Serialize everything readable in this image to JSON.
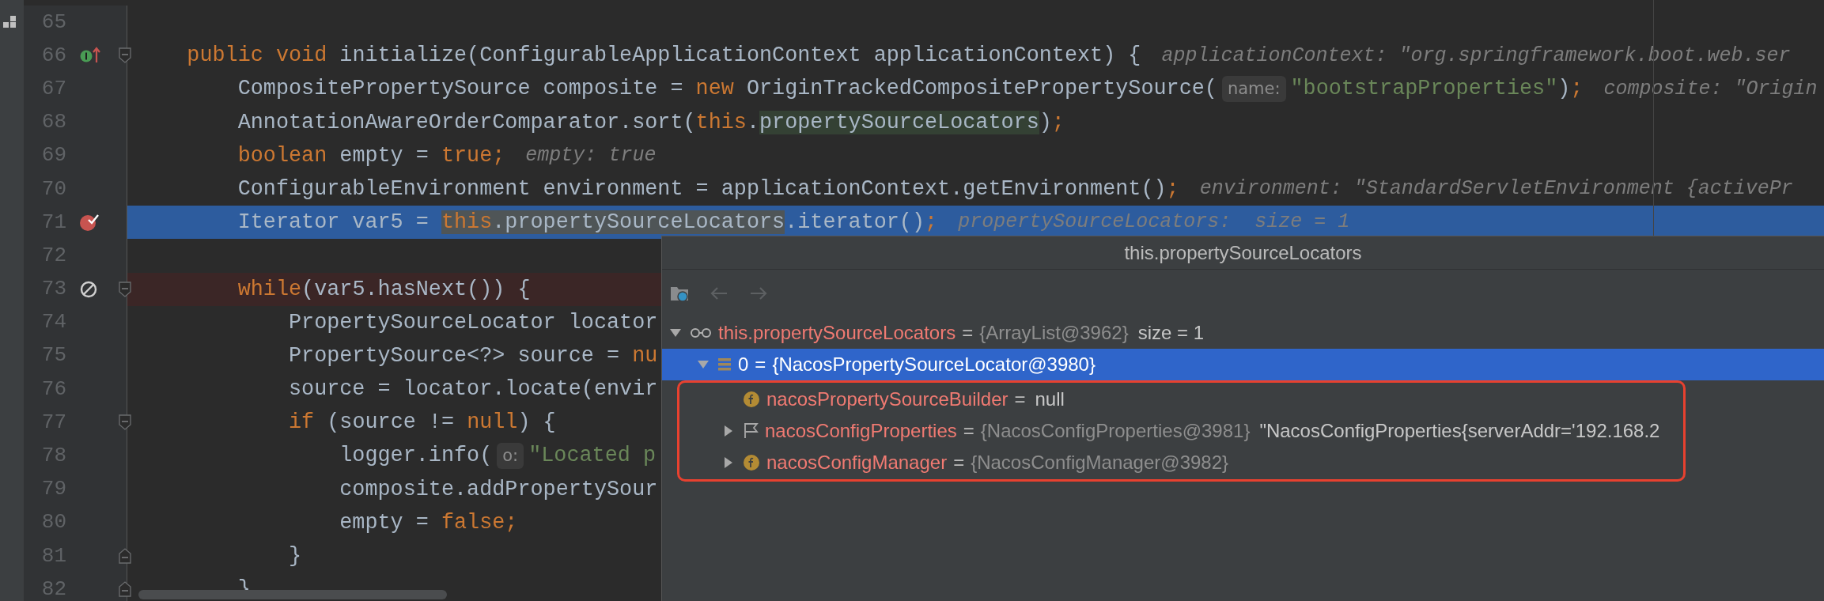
{
  "editor": {
    "lines": [
      {
        "number": "65",
        "current": false
      },
      {
        "number": "66",
        "current": false,
        "gutter_icon": {
          "kind": "implements"
        },
        "fold_marker": {
          "kind": "start"
        },
        "tokens": [
          {
            "text": "    public void",
            "kind": "keyword",
            "selected": false
          },
          {
            "text": " initialize(ConfigurableApplicationContext applicationContext) {",
            "kind": "plain",
            "selected": false
          },
          {
            "text": "applicationContext: \"org.springframework.boot.web.ser",
            "kind": "hint",
            "selected": false
          }
        ]
      },
      {
        "number": "67",
        "current": false,
        "tokens": [
          {
            "text": "        CompositePropertySource composite = ",
            "kind": "plain",
            "selected": false
          },
          {
            "text": "new",
            "kind": "keyword",
            "selected": false
          },
          {
            "text": " OriginTrackedCompositePropertySource(",
            "kind": "plain",
            "selected": false
          },
          {
            "text": "name:",
            "kind": "param",
            "selected": false
          },
          {
            "text": "\"bootstrapProperties\"",
            "kind": "string",
            "selected": false
          },
          {
            "text": ")",
            "kind": "plain",
            "selected": false
          },
          {
            "text": ";",
            "kind": "keyword",
            "selected": false
          },
          {
            "text": "composite: \"Origin",
            "kind": "hint",
            "selected": false
          }
        ]
      },
      {
        "number": "68",
        "current": false,
        "tokens": [
          {
            "text": "        AnnotationAwareOrderComparator.sort(",
            "kind": "plain",
            "selected": false
          },
          {
            "text": "this",
            "kind": "keyword",
            "selected": false
          },
          {
            "text": ".",
            "kind": "plain",
            "selected": false
          },
          {
            "text": "propertySourceLocators",
            "kind": "usage",
            "selected": false
          },
          {
            "text": ")",
            "kind": "plain",
            "selected": false
          },
          {
            "text": ";",
            "kind": "keyword",
            "selected": false
          }
        ]
      },
      {
        "number": "69",
        "current": false,
        "tokens": [
          {
            "text": "        boolean",
            "kind": "keyword",
            "selected": false
          },
          {
            "text": " empty = ",
            "kind": "plain",
            "selected": false
          },
          {
            "text": "true;",
            "kind": "keyword",
            "selected": false
          },
          {
            "text": "empty: true",
            "kind": "hint",
            "selected": false
          }
        ]
      },
      {
        "number": "70",
        "current": false,
        "tokens": [
          {
            "text": "        ConfigurableEnvironment environment = applicationContext.getEnvironment()",
            "kind": "plain",
            "selected": false
          },
          {
            "text": ";",
            "kind": "keyword",
            "selected": false
          },
          {
            "text": "environment: \"StandardServletEnvironment {activePr",
            "kind": "hint",
            "selected": false
          }
        ]
      },
      {
        "number": "71",
        "current": true,
        "gutter_icon": {
          "kind": "breakpoint",
          "enabled": true
        },
        "tokens": [
          {
            "text": "        Iterator var5 = ",
            "kind": "plain",
            "selected": false
          },
          {
            "text": "this",
            "kind": "keyword",
            "selected": true
          },
          {
            "text": ".propertySourceLocators",
            "kind": "plain",
            "selected": true
          },
          {
            "text": ".iterator()",
            "kind": "plain",
            "selected": false
          },
          {
            "text": ";",
            "kind": "keyword",
            "selected": false
          },
          {
            "text": "propertySourceLocators:  size = 1",
            "kind": "hint",
            "selected": false
          }
        ]
      },
      {
        "number": "72",
        "current": false
      },
      {
        "number": "73",
        "current": false,
        "gutter_icon": {
          "kind": "breakpoint",
          "enabled": false
        },
        "fold_marker": {
          "kind": "start"
        },
        "tokens": [
          {
            "text": "        while",
            "kind": "keyword",
            "selected": false
          },
          {
            "text": "(var5.hasNext()) {",
            "kind": "plain",
            "selected": false
          }
        ]
      },
      {
        "number": "74",
        "current": false,
        "tokens": [
          {
            "text": "            PropertySourceLocator locator",
            "kind": "plain",
            "selected": false
          }
        ]
      },
      {
        "number": "75",
        "current": false,
        "tokens": [
          {
            "text": "            PropertySource<?> source = ",
            "kind": "plain",
            "selected": false
          },
          {
            "text": "nu",
            "kind": "keyword",
            "selected": false
          }
        ]
      },
      {
        "number": "76",
        "current": false,
        "tokens": [
          {
            "text": "            source = locator.locate(envir",
            "kind": "plain",
            "selected": false
          }
        ]
      },
      {
        "number": "77",
        "current": false,
        "fold_marker": {
          "kind": "start"
        },
        "tokens": [
          {
            "text": "            if",
            "kind": "keyword",
            "selected": false
          },
          {
            "text": " (source != ",
            "kind": "plain",
            "selected": false
          },
          {
            "text": "null",
            "kind": "keyword",
            "selected": false
          },
          {
            "text": ") {",
            "kind": "plain",
            "selected": false
          }
        ]
      },
      {
        "number": "78",
        "current": false,
        "tokens": [
          {
            "text": "                logger.info(",
            "kind": "plain",
            "selected": false
          },
          {
            "text": "o:",
            "kind": "param",
            "selected": false
          },
          {
            "text": "\"Located p",
            "kind": "string",
            "selected": false
          }
        ]
      },
      {
        "number": "79",
        "current": false,
        "tokens": [
          {
            "text": "                composite.addPropertySour",
            "kind": "plain",
            "selected": false
          }
        ]
      },
      {
        "number": "80",
        "current": false,
        "tokens": [
          {
            "text": "                empty = ",
            "kind": "plain",
            "selected": false
          },
          {
            "text": "false;",
            "kind": "keyword",
            "selected": false
          }
        ]
      },
      {
        "number": "81",
        "current": false,
        "fold_marker": {
          "kind": "end"
        },
        "tokens": [
          {
            "text": "            }",
            "kind": "plain",
            "selected": false
          }
        ]
      },
      {
        "number": "82",
        "current": false,
        "fold_marker": {
          "kind": "end"
        },
        "tokens": [
          {
            "text": "        }",
            "kind": "plain",
            "selected": false
          }
        ]
      }
    ]
  },
  "popup": {
    "title": "this.propertySourceLocators",
    "nav": [
      {
        "kind": "back",
        "enabled": false
      },
      {
        "kind": "forward",
        "enabled": false
      }
    ],
    "tree": [
      {
        "kind": "watch",
        "expandable": true,
        "expanded": true,
        "name": "this.propertySourceLocators",
        "operator": "=",
        "value": "{ArrayList@3962}",
        "text": "size = 1",
        "selected": false,
        "outlined_children": false,
        "children": [
          {
            "kind": "element",
            "expandable": true,
            "expanded": true,
            "name": "0",
            "operator": "=",
            "value": "{NacosPropertySourceLocator@3980}",
            "selected": true,
            "outlined_children": true,
            "children": [
              {
                "kind": "field",
                "expandable": false,
                "name": "nacosPropertySourceBuilder",
                "operator": "=",
                "text": "null",
                "selected": false
              },
              {
                "kind": "flag",
                "expandable": true,
                "expanded": false,
                "name": "nacosConfigProperties",
                "operator": "=",
                "value": "{NacosConfigProperties@3981}",
                "text": "\"NacosConfigProperties{serverAddr='192.168.2",
                "selected": false
              },
              {
                "kind": "field",
                "expandable": true,
                "expanded": false,
                "name": "nacosConfigManager",
                "operator": "=",
                "value": "{NacosConfigManager@3982}",
                "selected": false
              }
            ]
          }
        ]
      }
    ]
  }
}
